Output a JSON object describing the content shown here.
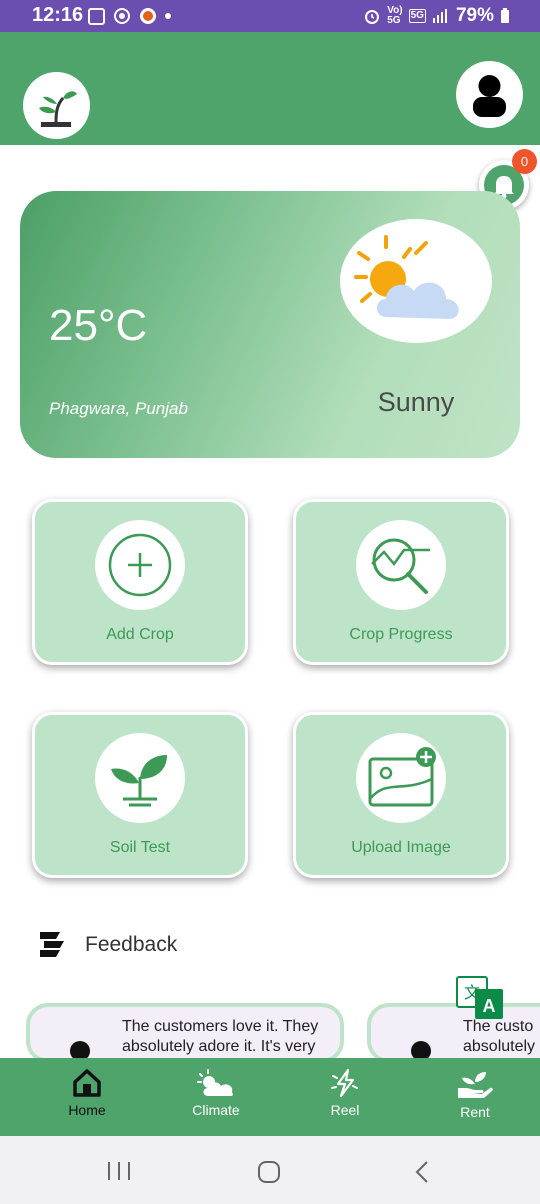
{
  "status_bar": {
    "time": "12:16",
    "battery": "79%",
    "network_top": "Vo)",
    "network_bottom": "5G",
    "network_type": "5G"
  },
  "header": {
    "logo_icon": "plant-sprout-icon",
    "profile_icon": "user-icon"
  },
  "notifications": {
    "count": "0",
    "icon": "bell-icon"
  },
  "weather": {
    "temperature": "25°C",
    "location": "Phagwara, Punjab",
    "condition": "Sunny",
    "icon": "sun-behind-cloud-icon"
  },
  "actions": [
    {
      "label": "Add Crop",
      "icon": "plus-circle-icon"
    },
    {
      "label": "Crop Progress",
      "icon": "chart-magnifier-icon"
    },
    {
      "label": "Soil Test",
      "icon": "sprout-icon"
    },
    {
      "label": "Upload Image",
      "icon": "add-image-icon"
    }
  ],
  "feedback": {
    "title": "Feedback",
    "icon": "feedback-icon",
    "cards": [
      {
        "text": "The customers love it. They absolutely adore it. It's very"
      },
      {
        "text": "The custo absolutely"
      }
    ]
  },
  "bottom_nav": [
    {
      "label": "Home",
      "icon": "home-icon"
    },
    {
      "label": "Climate",
      "icon": "sun-cloud-icon"
    },
    {
      "label": "Reel",
      "icon": "lightning-icon"
    },
    {
      "label": "Rent",
      "icon": "hand-plant-icon"
    }
  ],
  "colors": {
    "brand_green": "#4ea46a",
    "tile_green": "#bde3c8",
    "status_purple": "#6a4fb0",
    "badge_orange": "#f0542a"
  }
}
